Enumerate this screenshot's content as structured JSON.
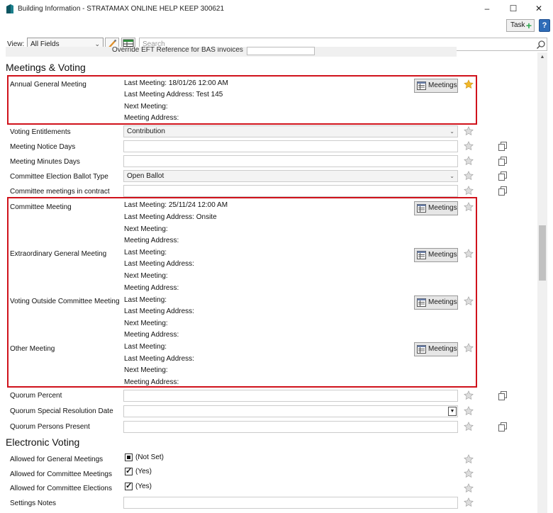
{
  "window": {
    "title": "Building Information - STRATAMAX ONLINE HELP KEEP 300621",
    "minimize": "–",
    "maximize": "☐",
    "close": "✕"
  },
  "toolbar": {
    "task_label": "Task",
    "help_label": "?",
    "view_label": "View:",
    "view_selected": "All Fields",
    "search_placeholder": "Search"
  },
  "cutoff_row_label": "Override EFT Reference for BAS invoices",
  "sections": {
    "meetings_voting": "Meetings & Voting",
    "electronic_voting": "Electronic Voting"
  },
  "meeting_detail_labels": {
    "last_meeting": "Last Meeting:",
    "last_meeting_address": "Last Meeting Address:",
    "next_meeting": "Next Meeting:",
    "meeting_address": "Meeting Address:"
  },
  "meetings_button_label": "Meetings",
  "agm": {
    "label": "Annual General Meeting",
    "last_meeting": "Last Meeting: 18/01/26 12:00 AM",
    "last_meeting_address": "Last Meeting Address: Test 145",
    "next_meeting": "Next Meeting:",
    "meeting_address": "Meeting Address:"
  },
  "fields": {
    "voting_entitlements": {
      "label": "Voting Entitlements",
      "value": "Contribution"
    },
    "meeting_notice_days": {
      "label": "Meeting Notice Days",
      "value": ""
    },
    "meeting_minutes_days": {
      "label": "Meeting Minutes Days",
      "value": ""
    },
    "committee_election_ballot_type": {
      "label": "Committee Election Ballot Type",
      "value": "Open Ballot"
    },
    "committee_meetings_in_contract": {
      "label": "Committee meetings in contract",
      "value": ""
    },
    "quorum_percent": {
      "label": "Quorum Percent",
      "value": ""
    },
    "quorum_special_resolution_date": {
      "label": "Quorum Special Resolution Date",
      "value": ""
    },
    "quorum_persons_present": {
      "label": "Quorum Persons Present",
      "value": ""
    },
    "settings_notes": {
      "label": "Settings Notes",
      "value": ""
    }
  },
  "meetings": [
    {
      "label": "Committee Meeting",
      "last_meeting": "Last Meeting: 25/11/24 12:00 AM",
      "last_meeting_address": "Last Meeting Address: Onsite",
      "next_meeting": "Next Meeting:",
      "meeting_address": "Meeting Address:"
    },
    {
      "label": "Extraordinary General Meeting",
      "last_meeting": "Last Meeting:",
      "last_meeting_address": "Last Meeting Address:",
      "next_meeting": "Next Meeting:",
      "meeting_address": "Meeting Address:"
    },
    {
      "label": "Voting Outside Committee Meeting",
      "last_meeting": "Last Meeting:",
      "last_meeting_address": "Last Meeting Address:",
      "next_meeting": "Next Meeting:",
      "meeting_address": "Meeting Address:"
    },
    {
      "label": "Other Meeting",
      "last_meeting": "Last Meeting:",
      "last_meeting_address": "Last Meeting Address:",
      "next_meeting": "Next Meeting:",
      "meeting_address": "Meeting Address:"
    }
  ],
  "electronic_voting": {
    "general": {
      "label": "Allowed for General Meetings",
      "value": "(Not Set)",
      "state": "indeterminate"
    },
    "committee_meetings": {
      "label": "Allowed for Committee Meetings",
      "value": "(Yes)",
      "state": "checked"
    },
    "committee_elections": {
      "label": "Allowed for Committee Elections",
      "value": "(Yes)",
      "state": "checked"
    }
  },
  "colors": {
    "highlight_border": "#d0121b",
    "star_active": "#f2b829",
    "star_inactive": "#c8c8c8",
    "help_button": "#2e6cb8",
    "task_plus": "#2fa84f"
  },
  "icons": {
    "app": "building-app-icon",
    "star": "star-icon",
    "copy": "copy-icon",
    "meetings": "calendar-list-icon",
    "search": "search-icon",
    "edit": "pencil-icon",
    "grid": "grid-icon"
  }
}
